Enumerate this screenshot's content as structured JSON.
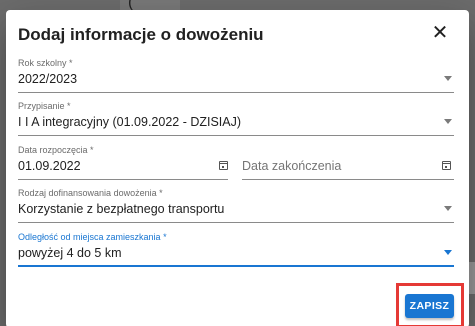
{
  "background": {
    "glyph": "("
  },
  "dialog": {
    "title": "Dodaj informacje o dowożeniu",
    "close_icon": "close-icon",
    "fields": {
      "school_year": {
        "label": "Rok szkolny *",
        "value": "2022/2023"
      },
      "assignment": {
        "label": "Przypisanie *",
        "value": "I I A integracyjny (01.09.2022 - DZISIAJ)"
      },
      "start_date": {
        "label": "Data rozpoczęcia *",
        "value": "01.09.2022"
      },
      "end_date": {
        "placeholder": "Data zakończenia"
      },
      "funding_type": {
        "label": "Rodzaj dofinansowania dowożenia *",
        "value": "Korzystanie z bezpłatnego transportu"
      },
      "distance": {
        "label": "Odległość od miejsca zamieszkania *",
        "value": "powyżej 4 do 5 km"
      }
    },
    "save_label": "ZAPISZ"
  },
  "colors": {
    "accent": "#1976d2",
    "highlight": "#e53935"
  }
}
